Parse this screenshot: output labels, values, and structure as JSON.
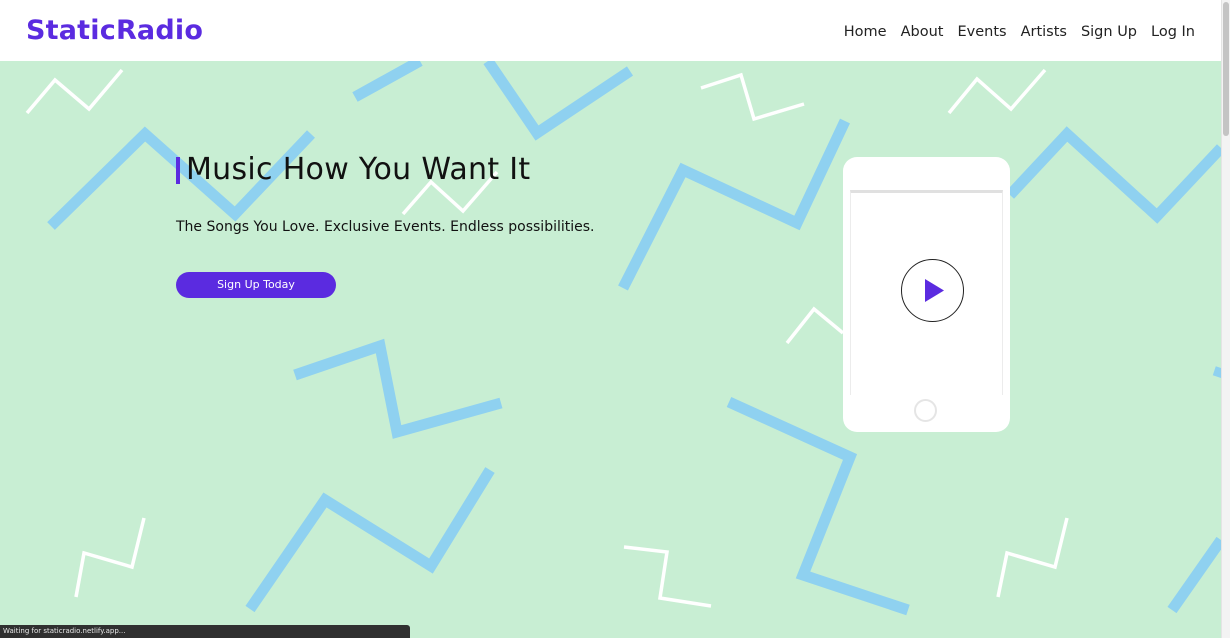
{
  "brand": {
    "name": "StaticRadio"
  },
  "nav": {
    "items": [
      {
        "label": "Home"
      },
      {
        "label": "About"
      },
      {
        "label": "Events"
      },
      {
        "label": "Artists"
      },
      {
        "label": "Sign Up"
      },
      {
        "label": "Log In"
      }
    ]
  },
  "hero": {
    "headline": "Music How You Want It",
    "subheadline": "The Songs You Love. Exclusive Events. Endless possibilities.",
    "cta_label": "Sign Up Today"
  },
  "phone": {
    "play_icon": "play-icon"
  },
  "status_bar": {
    "text": "Waiting for staticradio.netlify.app..."
  },
  "colors": {
    "brand": "#5b2be0",
    "hero_background": "#c8eed3",
    "zigzag_blue": "#8fd1f0",
    "zigzag_white": "#ffffff"
  }
}
